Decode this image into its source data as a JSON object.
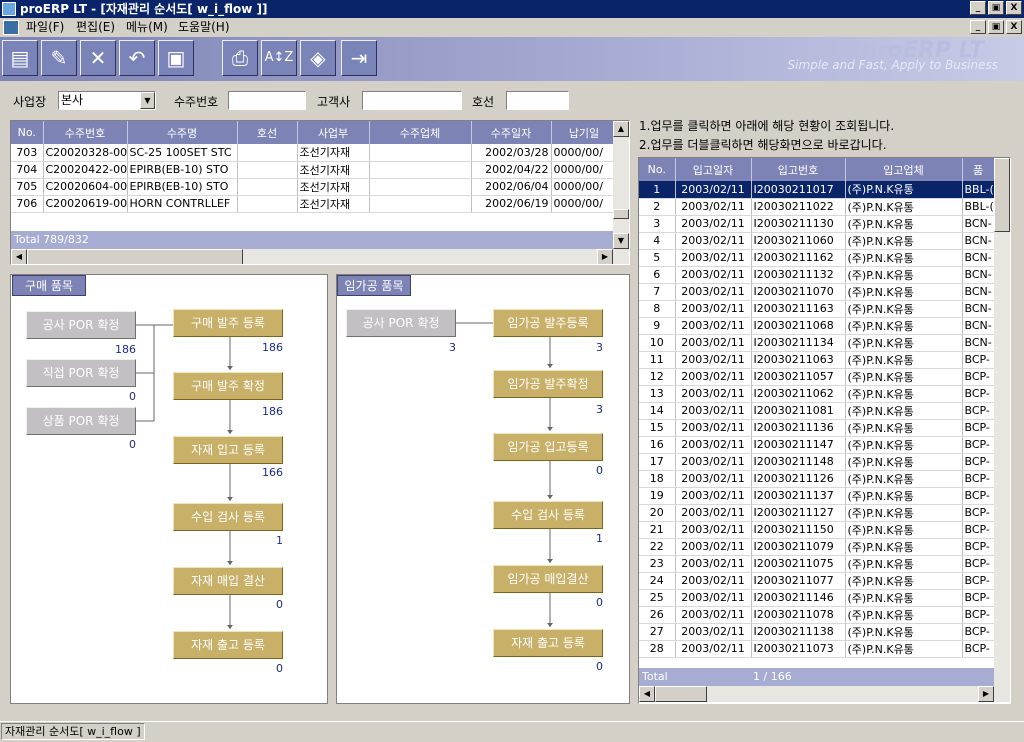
{
  "window": {
    "title": "proERP LT - [자재관리 순서도[ w_i_flow ]]",
    "min": "_",
    "max": "▣",
    "close": "X"
  },
  "menu": [
    "파일(F)",
    "편집(E)",
    "메뉴(M)",
    "도움말(H)"
  ],
  "toolbar": {
    "buttons": [
      "new-icon",
      "edit-icon",
      "delete-icon",
      "undo-icon",
      "save-icon",
      "print-icon",
      "sort-icon",
      "filter-icon",
      "exit-icon"
    ],
    "tagline": "Simple and Fast, Apply to Business",
    "brand": "proERP LT"
  },
  "filters": {
    "site_label": "사업장",
    "site_value": "본사",
    "order_no_label": "수주번호",
    "order_no_value": "",
    "customer_label": "고객사",
    "customer_value": "",
    "hull_label": "호선",
    "hull_value": ""
  },
  "orders": {
    "columns": [
      "No.",
      "수주번호",
      "수주명",
      "호선",
      "사업부",
      "수주업체",
      "수주일자",
      "납기일"
    ],
    "rows": [
      [
        "703",
        "C20020328-00",
        "SC-25 100SET STC",
        "",
        "조선기자재",
        "",
        "2002/03/28",
        "0000/00/"
      ],
      [
        "704",
        "C20020422-00",
        "EPIRB(EB-10) STO",
        "",
        "조선기자재",
        "",
        "2002/04/22",
        "0000/00/"
      ],
      [
        "705",
        "C20020604-00",
        "EPIRB(EB-10) STO",
        "",
        "조선기자재",
        "",
        "2002/06/04",
        "0000/00/"
      ],
      [
        "706",
        "C20020619-00",
        "HORN CONTRLLEF",
        "",
        "조선기자재",
        "",
        "2002/06/19",
        "0000/00/"
      ]
    ],
    "total": "Total  789/832"
  },
  "purchase": {
    "title": "구매 품목",
    "left": [
      {
        "label": "공사 POR 확정",
        "count": "186"
      },
      {
        "label": "직접 POR 확정",
        "count": "0"
      },
      {
        "label": "상품 POR 확정",
        "count": "0"
      }
    ],
    "steps": [
      {
        "label": "구매 발주 등록",
        "count": "186"
      },
      {
        "label": "구매 발주 확정",
        "count": "186"
      },
      {
        "label": "자재 입고 등록",
        "count": "166"
      },
      {
        "label": "수입 검사 등록",
        "count": "1"
      },
      {
        "label": "자재 매입 결산",
        "count": "0"
      },
      {
        "label": "자재 출고 등록",
        "count": "0"
      }
    ]
  },
  "outsource": {
    "title": "임가공 품목",
    "left": [
      {
        "label": "공사 POR 확정",
        "count": "3"
      }
    ],
    "steps": [
      {
        "label": "임가공 발주등록",
        "count": "3"
      },
      {
        "label": "임가공 발주확정",
        "count": "3"
      },
      {
        "label": "임가공 입고등록",
        "count": "0"
      },
      {
        "label": "수입 검사 등록",
        "count": "1"
      },
      {
        "label": "임가공 매입결산",
        "count": "0"
      },
      {
        "label": "자재 출고 등록",
        "count": "0"
      }
    ]
  },
  "notes": [
    "1.업무를 클릭하면 아래에 해당 현황이 조회됩니다.",
    "2.업무를 더블클릭하면 해당화면으로 바로갑니다."
  ],
  "receipts": {
    "columns": [
      "No.",
      "입고일자",
      "입고번호",
      "입고업체",
      "품"
    ],
    "rows": [
      [
        "1",
        "2003/02/11",
        "I20030211017",
        "(주)P.N.K유통",
        "BBL-("
      ],
      [
        "2",
        "2003/02/11",
        "I20030211022",
        "(주)P.N.K유통",
        "BBL-("
      ],
      [
        "3",
        "2003/02/11",
        "I20030211130",
        "(주)P.N.K유통",
        "BCN-"
      ],
      [
        "4",
        "2003/02/11",
        "I20030211060",
        "(주)P.N.K유통",
        "BCN-"
      ],
      [
        "5",
        "2003/02/11",
        "I20030211162",
        "(주)P.N.K유통",
        "BCN-"
      ],
      [
        "6",
        "2003/02/11",
        "I20030211132",
        "(주)P.N.K유통",
        "BCN-"
      ],
      [
        "7",
        "2003/02/11",
        "I20030211070",
        "(주)P.N.K유통",
        "BCN-"
      ],
      [
        "8",
        "2003/02/11",
        "I20030211163",
        "(주)P.N.K유통",
        "BCN-"
      ],
      [
        "9",
        "2003/02/11",
        "I20030211068",
        "(주)P.N.K유통",
        "BCN-"
      ],
      [
        "10",
        "2003/02/11",
        "I20030211134",
        "(주)P.N.K유통",
        "BCN-"
      ],
      [
        "11",
        "2003/02/11",
        "I20030211063",
        "(주)P.N.K유통",
        "BCP-"
      ],
      [
        "12",
        "2003/02/11",
        "I20030211057",
        "(주)P.N.K유통",
        "BCP-"
      ],
      [
        "13",
        "2003/02/11",
        "I20030211062",
        "(주)P.N.K유통",
        "BCP-"
      ],
      [
        "14",
        "2003/02/11",
        "I20030211081",
        "(주)P.N.K유통",
        "BCP-"
      ],
      [
        "15",
        "2003/02/11",
        "I20030211136",
        "(주)P.N.K유통",
        "BCP-"
      ],
      [
        "16",
        "2003/02/11",
        "I20030211147",
        "(주)P.N.K유통",
        "BCP-"
      ],
      [
        "17",
        "2003/02/11",
        "I20030211148",
        "(주)P.N.K유통",
        "BCP-"
      ],
      [
        "18",
        "2003/02/11",
        "I20030211126",
        "(주)P.N.K유통",
        "BCP-"
      ],
      [
        "19",
        "2003/02/11",
        "I20030211137",
        "(주)P.N.K유통",
        "BCP-"
      ],
      [
        "20",
        "2003/02/11",
        "I20030211127",
        "(주)P.N.K유통",
        "BCP-"
      ],
      [
        "21",
        "2003/02/11",
        "I20030211150",
        "(주)P.N.K유통",
        "BCP-"
      ],
      [
        "22",
        "2003/02/11",
        "I20030211079",
        "(주)P.N.K유통",
        "BCP-"
      ],
      [
        "23",
        "2003/02/11",
        "I20030211075",
        "(주)P.N.K유통",
        "BCP-"
      ],
      [
        "24",
        "2003/02/11",
        "I20030211077",
        "(주)P.N.K유통",
        "BCP-"
      ],
      [
        "25",
        "2003/02/11",
        "I20030211146",
        "(주)P.N.K유통",
        "BCP-"
      ],
      [
        "26",
        "2003/02/11",
        "I20030211078",
        "(주)P.N.K유통",
        "BCP-"
      ],
      [
        "27",
        "2003/02/11",
        "I20030211138",
        "(주)P.N.K유통",
        "BCP-"
      ],
      [
        "28",
        "2003/02/11",
        "I20030211073",
        "(주)P.N.K유통",
        "BCP-"
      ]
    ],
    "total_label": "Total",
    "page": "1 / 166"
  },
  "status": "자재관리 순서도[ w_i_flow ]",
  "colors": {
    "header": "#7d83b4",
    "flow_box": "#c8b068",
    "gray_box": "#c2c0c2",
    "selected": "#0a246a"
  }
}
